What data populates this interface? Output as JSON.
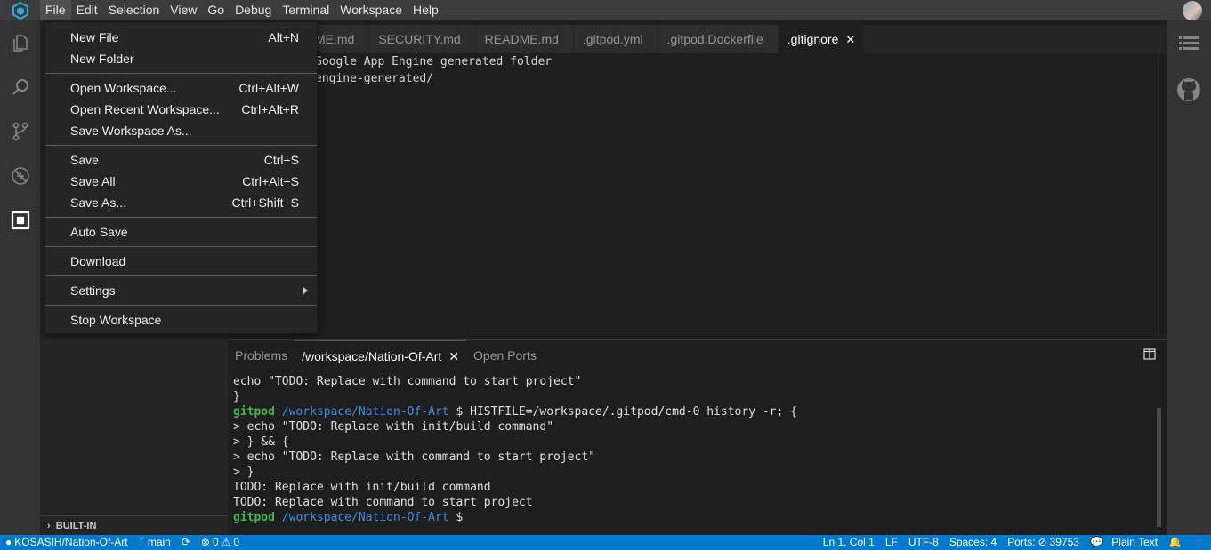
{
  "menubar": {
    "items": [
      "File",
      "Edit",
      "Selection",
      "View",
      "Go",
      "Debug",
      "Terminal",
      "Workspace",
      "Help"
    ],
    "active": "File"
  },
  "tabs": [
    {
      "label": "README.md",
      "visible_label": "ME.md"
    },
    {
      "label": "SECURITY.md"
    },
    {
      "label": "README.md"
    },
    {
      "label": ".gitpod.yml"
    },
    {
      "label": ".gitpod.Dockerfile"
    },
    {
      "label": ".gitignore",
      "active": true
    }
  ],
  "editor": {
    "lines": [
      "Google App Engine generated folder",
      "engine-generated/"
    ]
  },
  "sidebar": {
    "builtin_label": "BUILT-IN"
  },
  "file_menu": {
    "groups": [
      [
        {
          "label": "New File",
          "shortcut": "Alt+N"
        },
        {
          "label": "New Folder",
          "shortcut": ""
        }
      ],
      [
        {
          "label": "Open Workspace...",
          "shortcut": "Ctrl+Alt+W"
        },
        {
          "label": "Open Recent Workspace...",
          "shortcut": "Ctrl+Alt+R"
        },
        {
          "label": "Save Workspace As...",
          "shortcut": ""
        }
      ],
      [
        {
          "label": "Save",
          "shortcut": "Ctrl+S"
        },
        {
          "label": "Save All",
          "shortcut": "Ctrl+Alt+S"
        },
        {
          "label": "Save As...",
          "shortcut": "Ctrl+Shift+S"
        }
      ],
      [
        {
          "label": "Auto Save",
          "shortcut": ""
        }
      ],
      [
        {
          "label": "Download",
          "shortcut": ""
        }
      ],
      [
        {
          "label": "Settings",
          "shortcut": "",
          "submenu": true
        }
      ],
      [
        {
          "label": "Stop Workspace",
          "shortcut": ""
        }
      ]
    ]
  },
  "panel": {
    "tabs": [
      {
        "label": "Problems"
      },
      {
        "label": "/workspace/Nation-Of-Art",
        "active": true
      },
      {
        "label": "Open Ports"
      }
    ],
    "terminal": {
      "prompt_user": "gitpod",
      "prompt_path": "/workspace/Nation-Of-Art",
      "prompt_symbol": "$",
      "history_cmd": " HISTFILE=/workspace/.gitpod/cmd-0 history -r; {",
      "lines_before": [
        "echo \"TODO: Replace with command to start project\"",
        "}"
      ],
      "lines_after": [
        "> echo \"TODO: Replace with init/build command\"",
        "> } && {",
        "> echo \"TODO: Replace with command to start project\"",
        "> }",
        "TODO: Replace with init/build command",
        "TODO: Replace with command to start project"
      ]
    }
  },
  "statusbar": {
    "repo": "KOSASIH/Nation-Of-Art",
    "branch": "main",
    "errors": "0",
    "warnings": "0",
    "position": "Ln 1, Col 1",
    "eol": "LF",
    "encoding": "UTF-8",
    "spaces": "Spaces: 4",
    "ports_label": "Ports:",
    "ports_value": "39753",
    "language": "Plain Text"
  },
  "colors": {
    "statusbar": "#007acc",
    "prompt_green": "#3fb950",
    "prompt_blue": "#3b8eea",
    "logo": "#29a8e0"
  }
}
